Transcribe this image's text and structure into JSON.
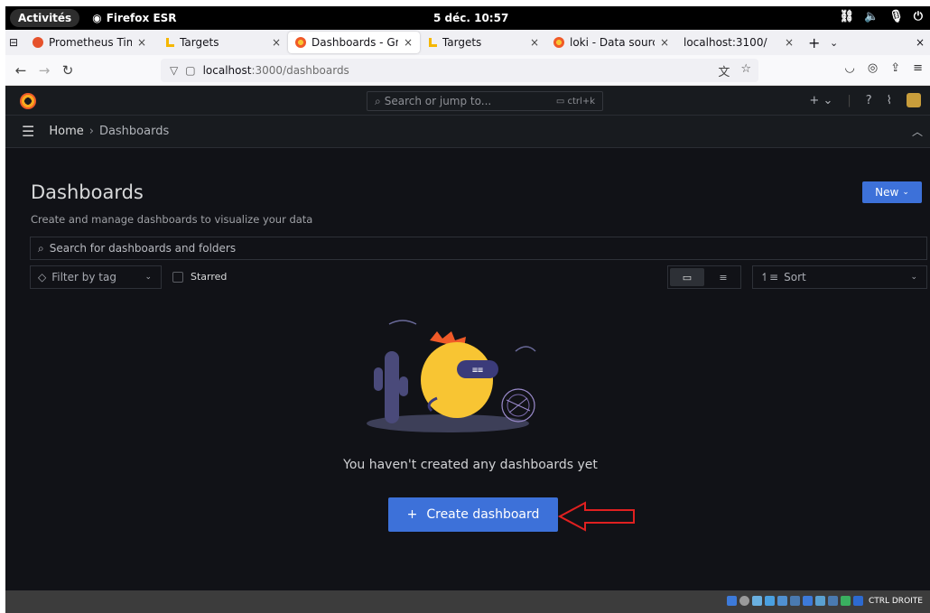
{
  "gnome": {
    "activities": "Activités",
    "app_name": "Firefox ESR",
    "clock": "5 déc.  10:57"
  },
  "tabs": [
    {
      "label": "Prometheus Time S",
      "icon": "prometheus-icon"
    },
    {
      "label": "Targets",
      "icon": "targets-icon"
    },
    {
      "label": "Dashboards - Graf",
      "icon": "grafana-icon",
      "active": true
    },
    {
      "label": "Targets",
      "icon": "targets-icon"
    },
    {
      "label": "loki - Data sources",
      "icon": "grafana-icon"
    },
    {
      "label": "localhost:3100/",
      "icon": ""
    }
  ],
  "urlbar": {
    "host": "localhost",
    "path": ":3000/dashboards"
  },
  "grafana": {
    "search_placeholder": "Search or jump to...",
    "search_shortcut": "ctrl+k",
    "breadcrumb": {
      "home": "Home",
      "current": "Dashboards"
    },
    "page": {
      "title": "Dashboards",
      "subtitle": "Create and manage dashboards to visualize your data",
      "new_label": "New",
      "search_placeholder": "Search for dashboards and folders",
      "tag_filter_label": "Filter by tag",
      "starred_label": "Starred",
      "sort_label": "Sort",
      "empty_message": "You haven't created any dashboards yet",
      "create_label": "Create dashboard"
    }
  },
  "vbox": {
    "host_key": "CTRL DROITE"
  },
  "colors": {
    "accent": "#3d71d9",
    "annotation": "#e02020",
    "grafana_orange": "#f05a28"
  }
}
